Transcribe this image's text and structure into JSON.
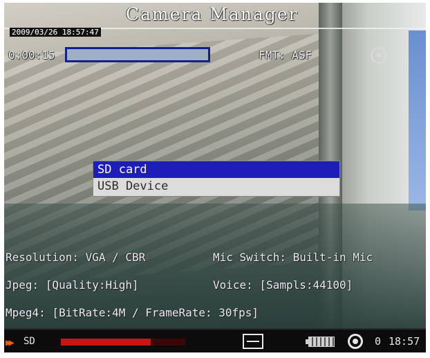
{
  "app": {
    "title": "Camera Manager"
  },
  "header": {
    "datetime": "2009/03/26 18:57:47",
    "elapsed": "0:00:15",
    "recording_progress": 1.0,
    "format": "FMT: ASF",
    "camera_icon": "camera-lens-icon"
  },
  "storage_menu": {
    "items": [
      {
        "label": "SD card",
        "selected": true
      },
      {
        "label": "USB Device",
        "selected": false
      }
    ]
  },
  "settings": {
    "resolution": "Resolution: VGA / CBR",
    "mic": "Mic Switch: Built-in Mic",
    "jpeg": "Jpeg: [Quality:High]",
    "voice": "Voice: [Sampls:44100]",
    "mpeg4": "Mpeg4: [BitRate:4M / FrameRate: 30fps]"
  },
  "status_bar": {
    "media": "SD",
    "storage_used": 0.72,
    "storage_color": "#c81414",
    "record_count": "0",
    "clock": "18:57",
    "icons": [
      "play-icon",
      "film-icon",
      "battery-icon",
      "record-icon"
    ]
  }
}
